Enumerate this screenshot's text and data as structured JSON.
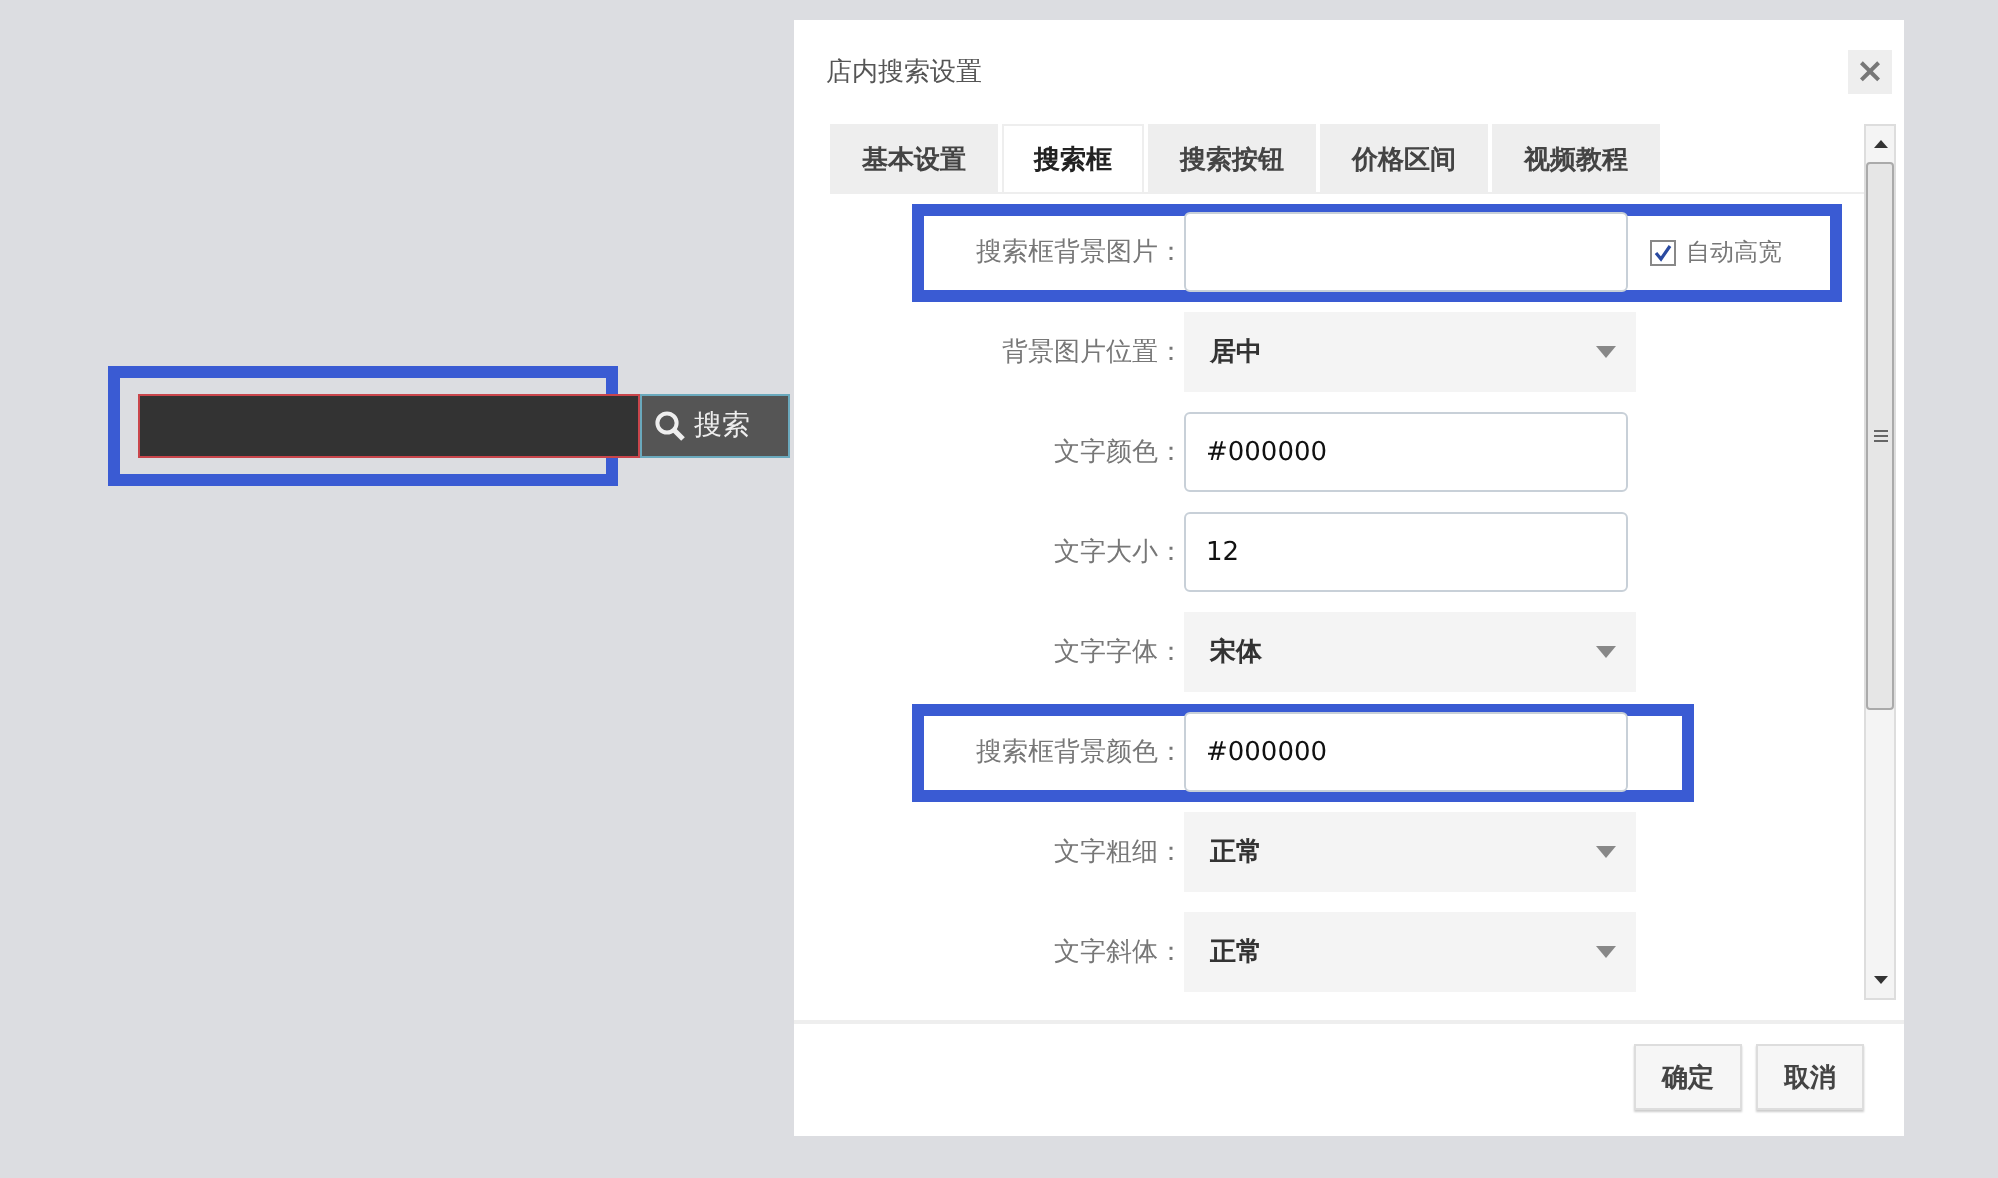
{
  "preview": {
    "highlighted": true,
    "button": "搜索"
  },
  "dialog": {
    "title": "店内搜索设置",
    "close": "×",
    "tabs": [
      {
        "label": "基本设置",
        "selected": false
      },
      {
        "label": "搜索框",
        "selected": true
      },
      {
        "label": "搜索按钮",
        "selected": false
      },
      {
        "label": "价格区间",
        "selected": false
      },
      {
        "label": "视频教程",
        "selected": false
      }
    ],
    "fields": [
      {
        "kind": "input",
        "label": "搜索框背景图片：",
        "highlighted": true,
        "checkbox": {
          "label": "自动高宽",
          "checked": true
        }
      },
      {
        "kind": "select",
        "label": "背景图片位置：",
        "value": "居中",
        "highlighted": false
      },
      {
        "kind": "input",
        "label": "文字颜色：",
        "value": "#000000",
        "highlighted": false
      },
      {
        "kind": "input",
        "label": "文字大小：",
        "value": "12",
        "highlighted": false
      },
      {
        "kind": "select",
        "label": "文字字体：",
        "value": "宋体",
        "highlighted": false
      },
      {
        "kind": "input",
        "label": "搜索框背景颜色：",
        "value": "#000000",
        "highlighted": true
      },
      {
        "kind": "select",
        "label": "文字粗细：",
        "value": "正常",
        "highlighted": false
      },
      {
        "kind": "select",
        "label": "文字斜体：",
        "value": "正常",
        "highlighted": false
      }
    ],
    "buttons": [
      "确定",
      "取消"
    ]
  }
}
